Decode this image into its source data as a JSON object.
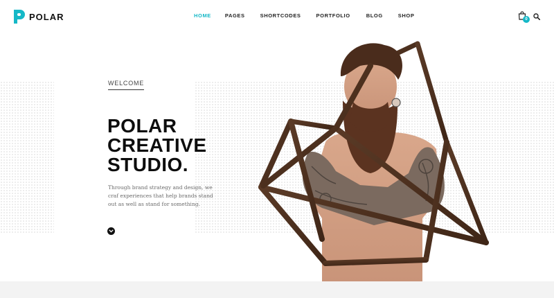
{
  "brand": {
    "name": "POLAR",
    "accent_color": "#15b8c7"
  },
  "nav": {
    "items": [
      {
        "label": "HOME",
        "active": true
      },
      {
        "label": "PAGES",
        "active": false
      },
      {
        "label": "SHORTCODES",
        "active": false
      },
      {
        "label": "PORTFOLIO",
        "active": false
      },
      {
        "label": "BLOG",
        "active": false
      },
      {
        "label": "SHOP",
        "active": false
      }
    ]
  },
  "header_icons": {
    "cart_icon": "shopping-bag-icon",
    "cart_count": "0",
    "search_icon": "search-icon"
  },
  "hero": {
    "eyebrow": "WELCOME",
    "headline_lines": [
      "POLAR",
      "CREATIVE",
      "STUDIO."
    ],
    "tagline": "Through brand strategy and design, we craf experiences that help brands stand out as well as stand for something.",
    "scroll_icon": "chevron-down-circle-icon",
    "image_subject": "bearded tattooed man with wooden geometric frame"
  }
}
